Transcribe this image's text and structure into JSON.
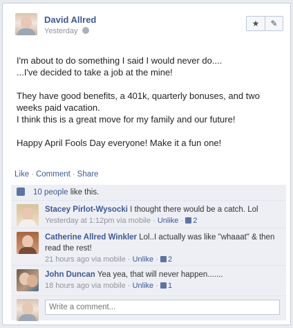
{
  "post": {
    "author": "David Allred",
    "time": "Yesterday",
    "paragraphs": [
      "I'm about to do something I said I would never do....\n...I've decided to take a job at the mine!",
      "They have good benefits, a 401k, quarterly bonuses, and two weeks paid vacation.\nI think this is a great move for my family and our future!",
      "Happy April Fools Day everyone! Make it a fun one!"
    ],
    "icons": {
      "privacy": "globe-icon",
      "star": "star-icon",
      "edit": "pencil-icon"
    }
  },
  "actions": {
    "like": "Like",
    "comment": "Comment",
    "share": "Share",
    "separator": "·"
  },
  "likes": {
    "people": "10 people",
    "suffix": " like this."
  },
  "comments": [
    {
      "name": "Stacey Pirlot-Wysocki",
      "text": "I thought there would be a catch. Lol",
      "time": "Yesterday at 1:12pm via mobile",
      "unlike": "Unlike",
      "count": "2"
    },
    {
      "name": "Catherine Allred Winkler",
      "text": "Lol..I actually was like \"whaaat\" & then read the rest!",
      "time": "21 hours ago via mobile",
      "unlike": "Unlike",
      "count": "2"
    },
    {
      "name": "John Duncan",
      "text": "Yea yea, that will never happen.......",
      "time": "18 hours ago via mobile",
      "unlike": "Unlike",
      "count": "1"
    }
  ],
  "compose": {
    "placeholder": "Write a comment..."
  }
}
